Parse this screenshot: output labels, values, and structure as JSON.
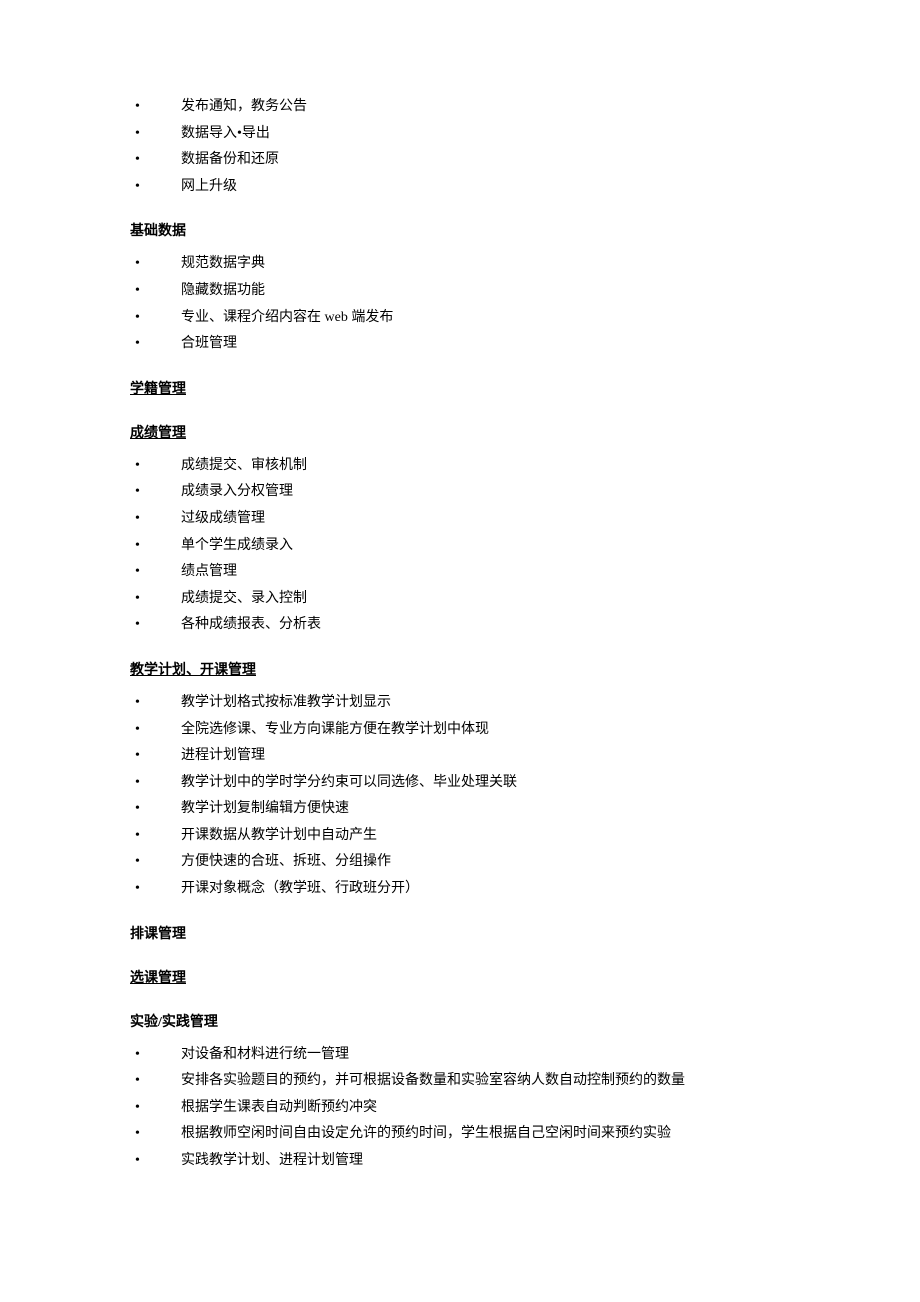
{
  "sections": [
    {
      "title": null,
      "underline": false,
      "items": [
        "发布通知，教务公告",
        "数据导入•导出",
        "数据备份和还原",
        "网上升级"
      ]
    },
    {
      "title": "基础数据",
      "underline": false,
      "items": [
        "规范数据字典",
        "隐藏数据功能",
        "专业、课程介绍内容在 web 端发布",
        "合班管理"
      ]
    },
    {
      "title": "学籍管理",
      "underline": true,
      "items": []
    },
    {
      "title": "成绩管理",
      "underline": true,
      "items": [
        "成绩提交、审核机制",
        "成绩录入分权管理",
        "过级成绩管理",
        "单个学生成绩录入",
        "绩点管理",
        "成绩提交、录入控制",
        "各种成绩报表、分析表"
      ]
    },
    {
      "title": "教学计划、开课管理",
      "underline": true,
      "items": [
        "教学计划格式按标准教学计划显示",
        "全院选修课、专业方向课能方便在教学计划中体现",
        "进程计划管理",
        "教学计划中的学时学分约束可以同选修、毕业处理关联",
        "教学计划复制编辑方便快速",
        "开课数据从教学计划中自动产生",
        "方便快速的合班、拆班、分组操作",
        "开课对象概念（教学班、行政班分开）"
      ]
    },
    {
      "title": "排课管理",
      "underline": false,
      "items": []
    },
    {
      "title": "选课管理",
      "underline": true,
      "items": []
    },
    {
      "title": "实验/实践管理",
      "underline": false,
      "items": [
        "对设备和材料进行统一管理",
        "安排各实验题目的预约，并可根据设备数量和实验室容纳人数自动控制预约的数量",
        "根据学生课表自动判断预约冲突",
        "根据教师空闲时间自由设定允许的预约时间，学生根据自己空闲时间来预约实验",
        "实践教学计划、进程计划管理"
      ]
    }
  ]
}
